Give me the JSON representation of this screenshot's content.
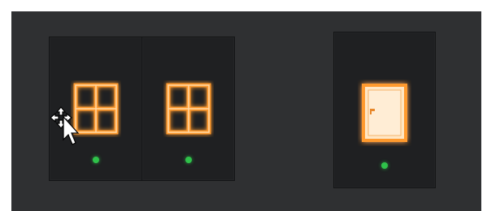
{
  "panel": {
    "background": "#2f3032"
  },
  "switches": [
    {
      "name": "window-switch-1",
      "icon": "window-icon",
      "state": "on",
      "indicator": "green"
    },
    {
      "name": "window-switch-2",
      "icon": "window-icon",
      "state": "on",
      "indicator": "green"
    },
    {
      "name": "door-switch",
      "icon": "door-icon",
      "state": "on",
      "indicator": "green"
    }
  ],
  "colors": {
    "glow": "#ff9a2e",
    "indicator": "#2fc24a",
    "switch_bg": "#1f2022"
  },
  "cursor": {
    "icon": "move-cursor-icon"
  }
}
